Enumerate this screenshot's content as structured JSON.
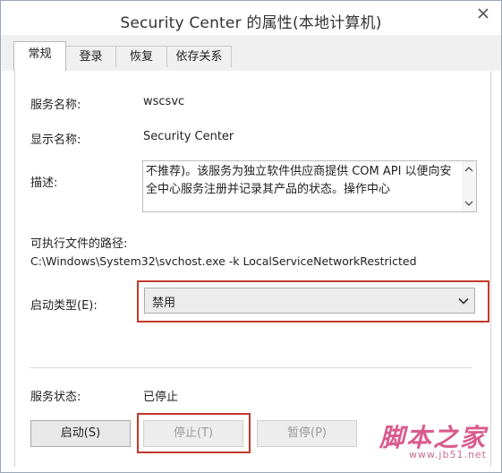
{
  "window": {
    "title": "Security Center 的属性(本地计算机)",
    "close_icon": "close-icon"
  },
  "tabs": [
    {
      "label": "常规",
      "active": true
    },
    {
      "label": "登录",
      "active": false
    },
    {
      "label": "恢复",
      "active": false
    },
    {
      "label": "依存关系",
      "active": false
    }
  ],
  "general": {
    "service_name_label": "服务名称:",
    "service_name_value": "wscsvc",
    "display_name_label": "显示名称:",
    "display_name_value": "Security Center",
    "description_label": "描述:",
    "description_text": "不推荐)。该服务为独立软件供应商提供 COM API 以便向安全中心服务注册并记录其产品的状态。操作中心",
    "exe_path_label": "可执行文件的路径:",
    "exe_path_value": "C:\\Windows\\System32\\svchost.exe -k LocalServiceNetworkRestricted",
    "startup_type_label": "启动类型(E):",
    "startup_type_value": "禁用",
    "service_status_label": "服务状态:",
    "service_status_value": "已停止"
  },
  "buttons": {
    "start": {
      "label": "启动(S)",
      "enabled": true
    },
    "stop": {
      "label": "停止(T)",
      "enabled": false
    },
    "pause": {
      "label": "暂停(P)",
      "enabled": false
    }
  },
  "highlight_color": "#c0392b",
  "watermark": {
    "text": "脚本之家",
    "url": "www.jb51.net"
  }
}
